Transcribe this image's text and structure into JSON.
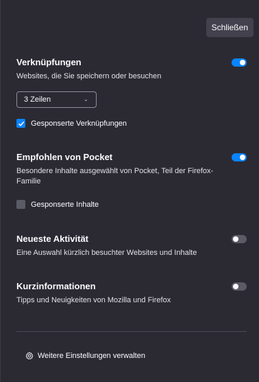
{
  "close_label": "Schließen",
  "sections": {
    "shortcuts": {
      "title": "Verknüpfungen",
      "desc": "Websites, die Sie speichern oder besuchen",
      "enabled": true,
      "rows_select": "3 Zeilen",
      "sponsored_label": "Gesponserte Verknüpfungen",
      "sponsored_checked": true
    },
    "pocket": {
      "title": "Empfohlen von Pocket",
      "desc": "Besondere Inhalte ausgewählt von Pocket, Teil der Firefox-Familie",
      "enabled": true,
      "sponsored_label": "Gesponserte Inhalte",
      "sponsored_checked": false
    },
    "activity": {
      "title": "Neueste Aktivität",
      "desc": "Eine Auswahl kürzlich besuchter Websites und Inhalte",
      "enabled": false
    },
    "snippets": {
      "title": "Kurzinformationen",
      "desc": "Tipps und Neuigkeiten von Mozilla und Firefox",
      "enabled": false
    }
  },
  "manage_label": "Weitere Einstellungen verwalten",
  "colors": {
    "accent": "#0a84ff",
    "panel_bg": "#2b2a33"
  }
}
